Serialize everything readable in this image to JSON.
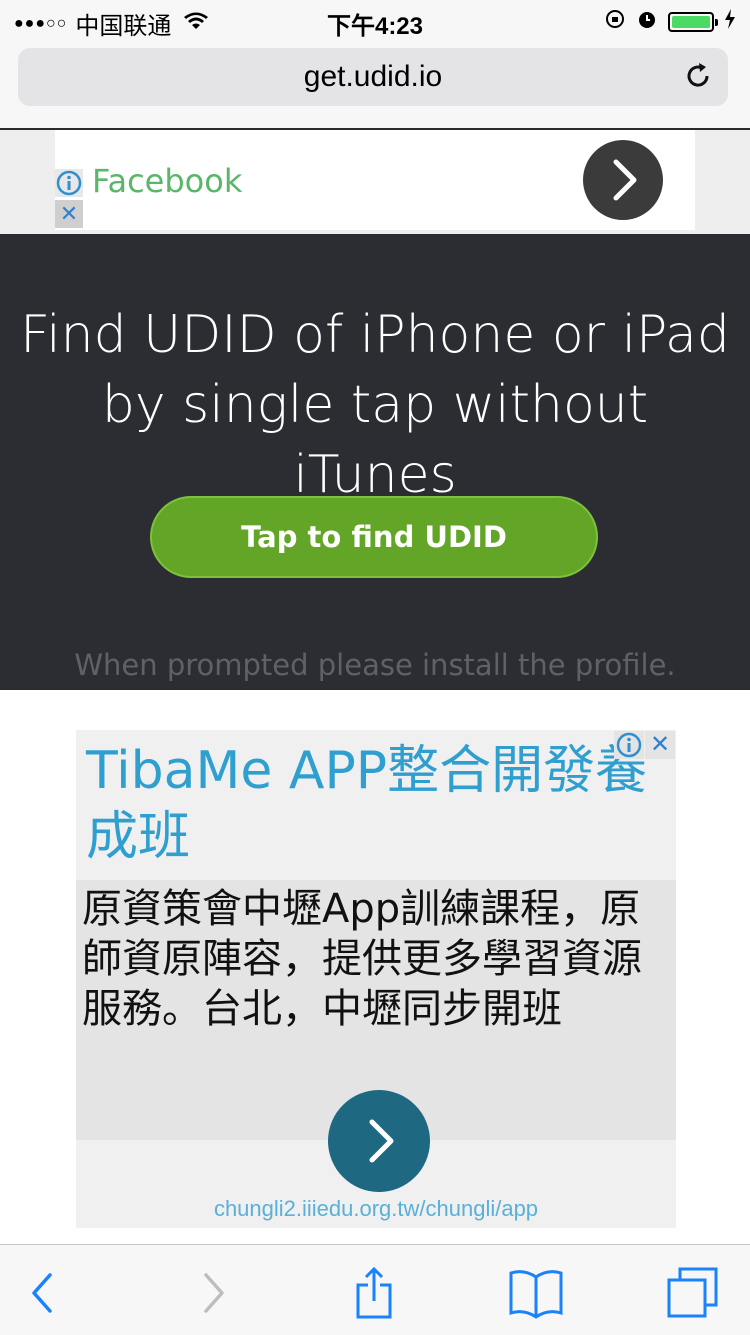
{
  "status_bar": {
    "signal": "●●●○○",
    "carrier": "中国联通",
    "time": "下午4:23",
    "battery_color": "#4cd964"
  },
  "browser": {
    "url": "get.udid.io"
  },
  "top_ad": {
    "label": "Facebook",
    "close_symbol": "✕"
  },
  "hero": {
    "headline_line1": "Find UDID of iPhone or iPad",
    "headline_line2": "by single tap without iTunes",
    "button_label": "Tap to find UDID",
    "hint": "When prompted please install the profile."
  },
  "bottom_ad": {
    "headline": "TibaMe APP整合開發養成班",
    "body": "原資策會中壢App訓練課程，原師資原陣容，提供更多學習資源服務。台北，中壢同步開班",
    "url": "chungli2.iiiedu.org.tw/chungli/app",
    "close_symbol": "✕"
  },
  "colors": {
    "hero_bg": "#2b2d33",
    "cta_green": "#63a526",
    "ad_headline": "#2f9fd0",
    "ios_blue": "#1a82fb"
  }
}
